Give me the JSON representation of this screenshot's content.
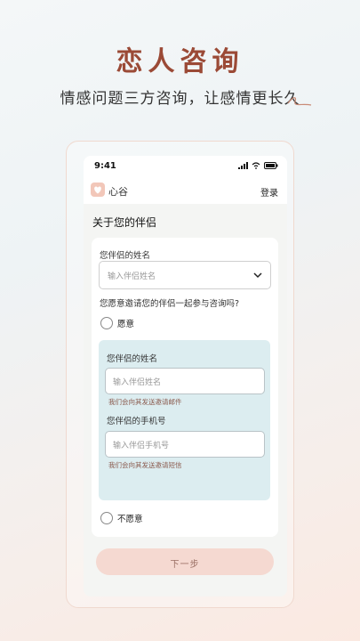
{
  "hero": {
    "title": "恋人咨询",
    "subtitle": "情感问题三方咨询，让感情更长久"
  },
  "status_bar": {
    "time": "9:41"
  },
  "app_bar": {
    "app_name": "心谷",
    "login_label": "登录"
  },
  "page": {
    "section_title": "关于您的伴侣"
  },
  "form": {
    "partner_name_label": "您伴侣的姓名",
    "partner_name_placeholder": "输入伴侣姓名",
    "invite_question": "您愿意邀请您的伴侣一起参与咨询吗?",
    "option_willing": "愿意",
    "sub": {
      "name_label": "您伴侣的姓名",
      "name_placeholder": "输入伴侣姓名",
      "name_hint": "我们会向其发送邀请邮件",
      "phone_label": "您伴侣的手机号",
      "phone_placeholder": "输入伴侣手机号",
      "phone_hint": "我们会向其发送邀请短信"
    },
    "option_unwilling": "不愿意",
    "next_label": "下一步"
  },
  "colors": {
    "accent": "#9b4a36",
    "button_bg": "#f5d9d1",
    "subform_bg": "#dcedf0"
  }
}
